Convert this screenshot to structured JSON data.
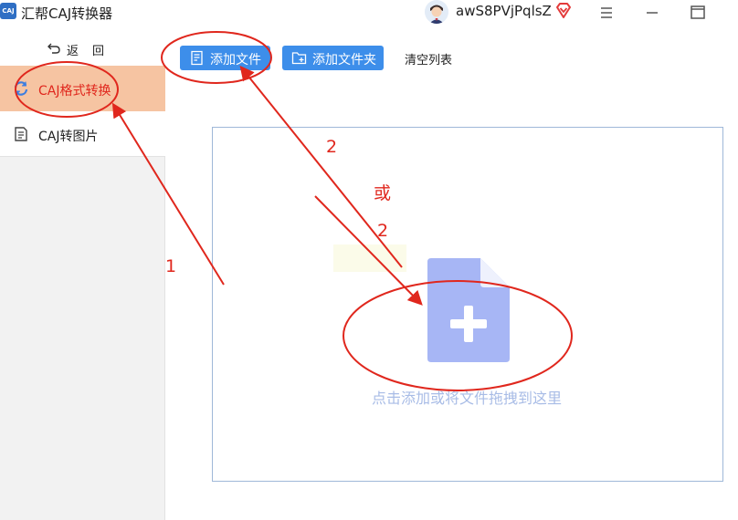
{
  "window": {
    "app_logo_text": "CAJ",
    "app_title": "汇帮CAJ转换器",
    "username": "awS8PVjPqlsZ",
    "icons": {
      "avatar": "user-avatar",
      "vip": "vip-diamond-icon",
      "menu": "hamburger-menu-icon",
      "minimize": "minimize-icon",
      "maximize": "maximize-icon"
    }
  },
  "sidebar": {
    "back_label_1": "返",
    "back_label_2": "回",
    "items": [
      {
        "label": "CAJ格式转换",
        "icon": "convert-icon",
        "active": true
      },
      {
        "label": "CAJ转图片",
        "icon": "document-icon",
        "active": false
      }
    ]
  },
  "toolbar": {
    "add_file": "添加文件",
    "add_folder": "添加文件夹",
    "clear_list": "清空列表"
  },
  "dropzone": {
    "hint": "点击添加或将文件拖拽到这里",
    "icon": "add-file-icon"
  },
  "annotations": {
    "step1": "1",
    "step2_top": "2",
    "or": "或",
    "step2_bottom": "2"
  },
  "colors": {
    "accent": "#3d8eea",
    "active_nav_bg": "#f6c4a2",
    "active_nav_text": "#e0271d",
    "annotation_red": "#e0271d",
    "drop_icon": "#a7b6f5"
  }
}
